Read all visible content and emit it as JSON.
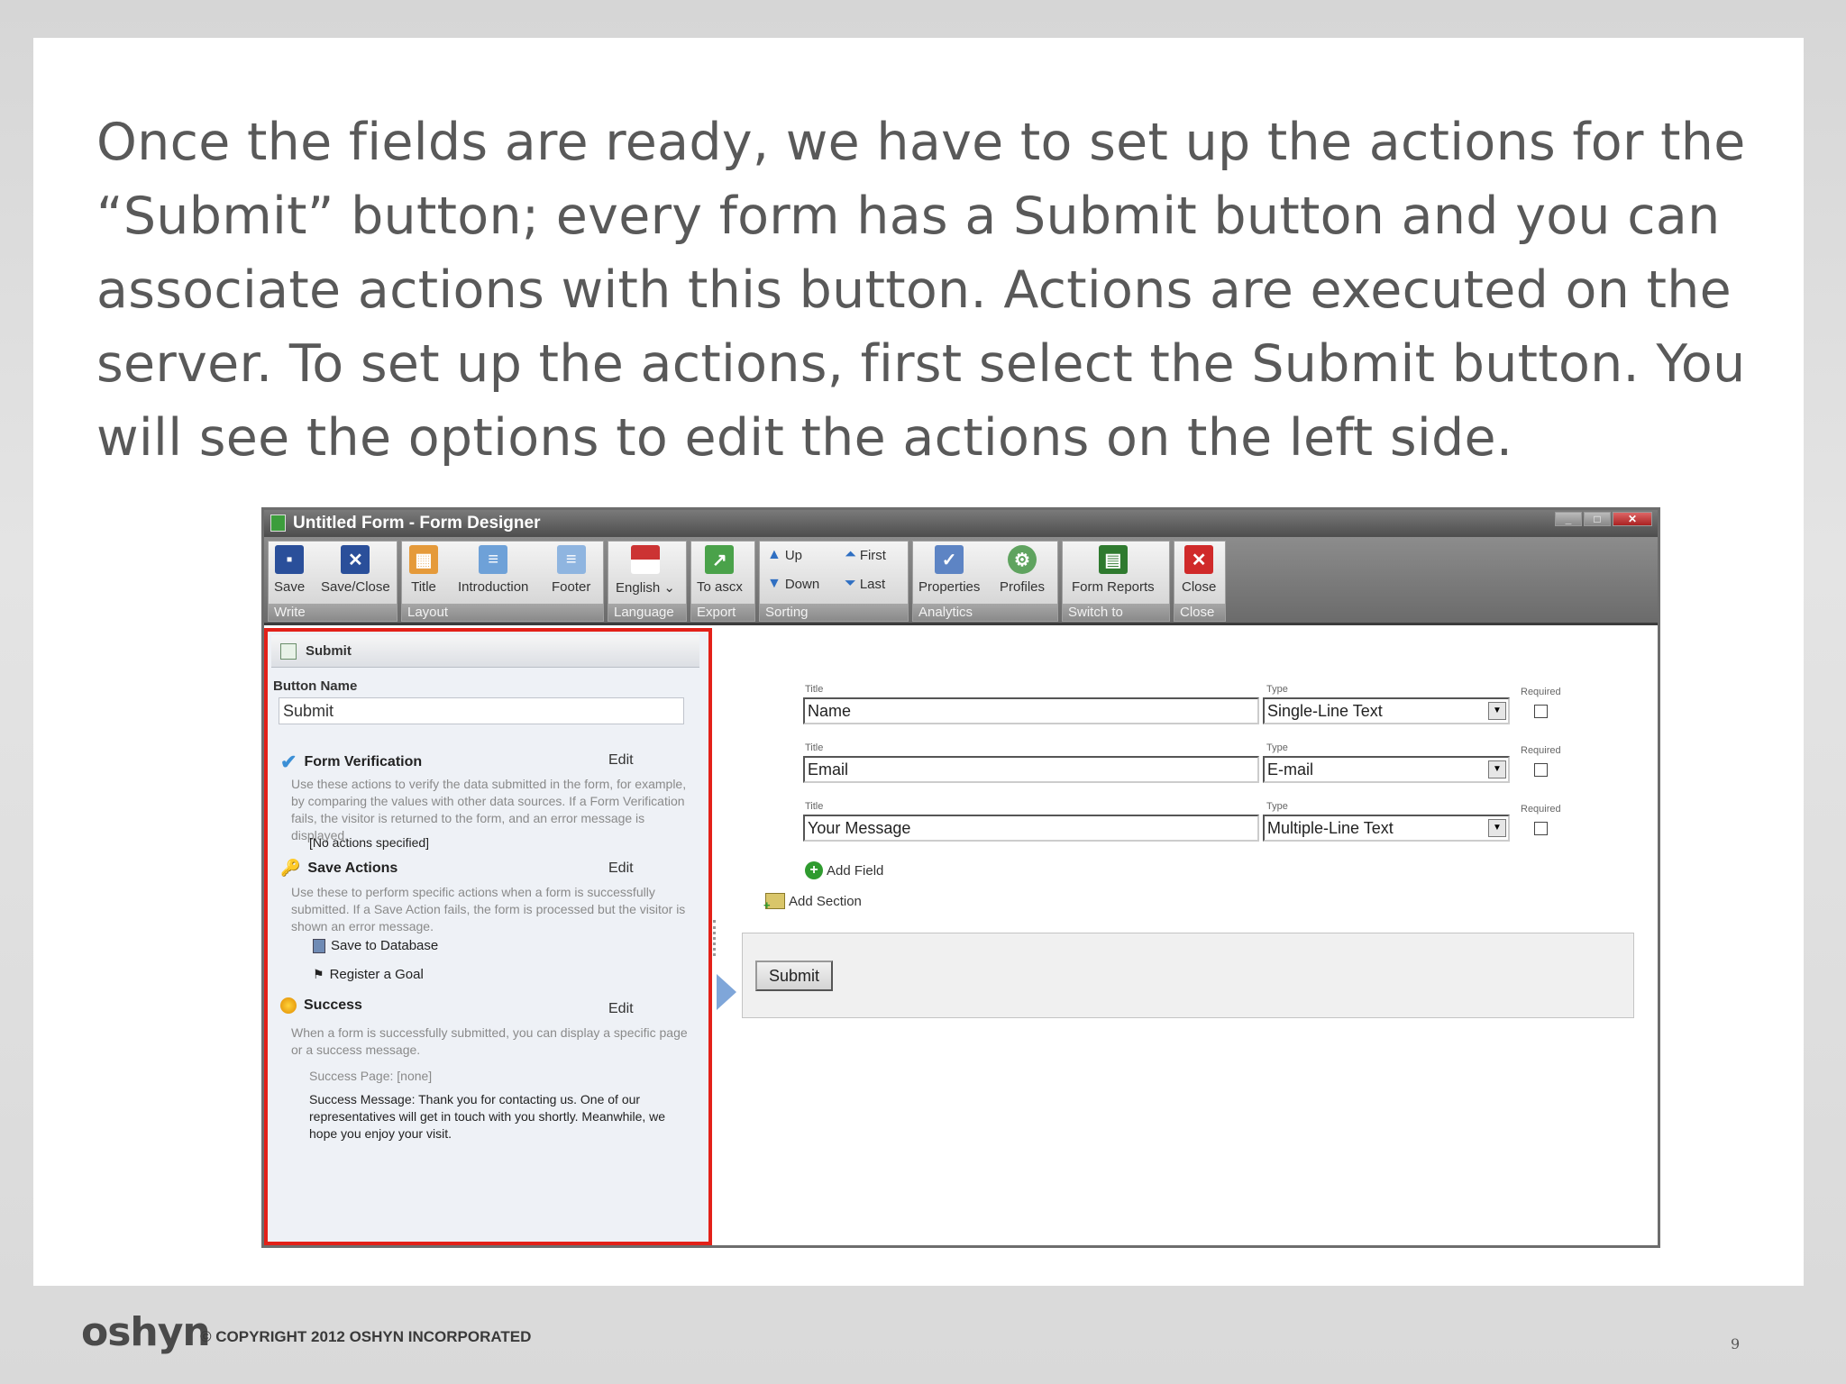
{
  "slide": {
    "body_text": "Once the fields are ready, we have to set up the actions for the “Submit” button; every form has a Submit button and you can associate actions with this button. Actions are executed on the server. To set up the actions, first select the Submit button. You will see the options to edit the actions on the left side."
  },
  "window": {
    "title": "Untitled Form - Form Designer"
  },
  "ribbon": {
    "save": "Save",
    "save_close": "Save/Close",
    "write_group": "Write",
    "title": "Title",
    "introduction": "Introduction",
    "footer": "Footer",
    "layout_group": "Layout",
    "english": "English ⌄",
    "language_group": "Language",
    "to_ascx": "To ascx",
    "export_group": "Export",
    "up": "Up",
    "down": "Down",
    "first": "First",
    "last": "Last",
    "sorting_group": "Sorting",
    "properties": "Properties",
    "profiles": "Profiles",
    "analytics_group": "Analytics",
    "form_reports": "Form Reports",
    "switch_group": "Switch to",
    "close": "Close",
    "close_group": "Close"
  },
  "left_panel": {
    "header": "Submit",
    "button_name_label": "Button Name",
    "button_name_value": "Submit",
    "form_verification": {
      "title": "Form Verification",
      "edit": "Edit",
      "description": "Use these actions to verify the data submitted in the form, for example, by comparing the values with other data sources. If a Form Verification fails, the visitor is returned to the form, and an error message is displayed.",
      "note": "[No actions specified]"
    },
    "save_actions": {
      "title": "Save Actions",
      "edit": "Edit",
      "description": "Use these to perform specific actions when a form is successfully submitted. If a Save Action fails, the form is processed but the visitor is shown an error message.",
      "items": [
        "Save to Database",
        "Register a Goal"
      ]
    },
    "success": {
      "title": "Success",
      "edit": "Edit",
      "description": "When a form is successfully submitted, you can display a specific page or a success message.",
      "page": "Success Page:   [none]",
      "message": "Success Message:   Thank you for contacting us. One of our representatives will get in touch with you shortly. Meanwhile, we hope you enjoy your visit."
    }
  },
  "fields": {
    "title_label": "Title",
    "type_label": "Type",
    "required_label": "Required",
    "rows": [
      {
        "title": "Name",
        "type": "Single-Line Text"
      },
      {
        "title": "Email",
        "type": "E-mail"
      },
      {
        "title": "Your Message",
        "type": "Multiple-Line Text"
      }
    ],
    "add_field": "Add Field",
    "add_section": "Add Section",
    "submit": "Submit"
  },
  "footer": {
    "logo": "oshyn",
    "copyright": "© COPYRIGHT 2012 OSHYN INCORPORATED",
    "page_number": "9"
  },
  "colors": {
    "highlight_border": "#e32119",
    "body_text": "#595959"
  }
}
